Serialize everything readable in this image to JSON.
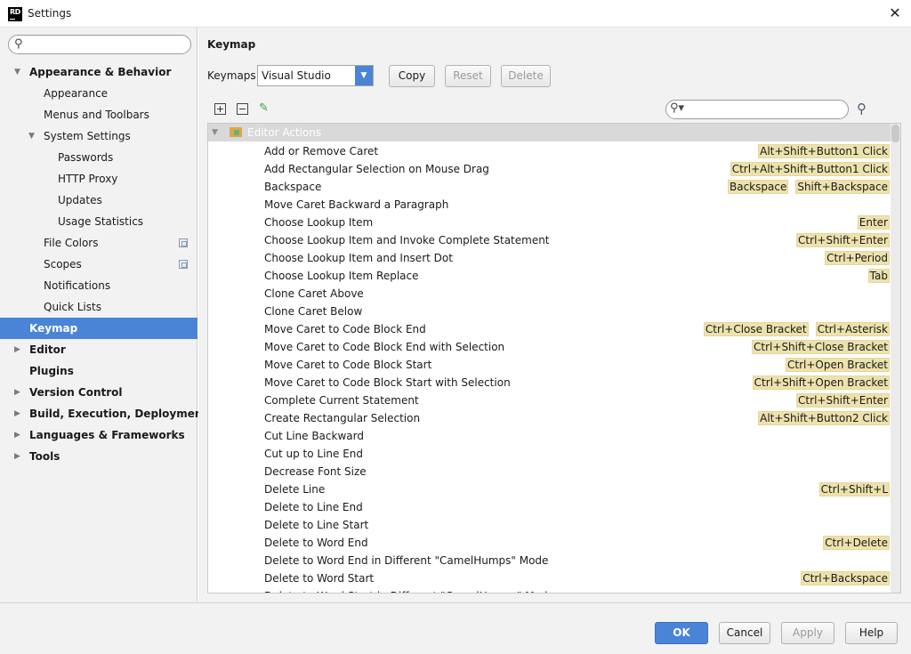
{
  "window": {
    "icon_text": "RD",
    "title": "Settings",
    "close_glyph": "✕"
  },
  "sidebar": {
    "search_placeholder": "",
    "items": [
      {
        "label": "Appearance & Behavior",
        "level": 0,
        "bold": true,
        "expanded": true
      },
      {
        "label": "Appearance",
        "level": 1
      },
      {
        "label": "Menus and Toolbars",
        "level": 1
      },
      {
        "label": "System Settings",
        "level": 1,
        "expanded": true
      },
      {
        "label": "Passwords",
        "level": 2
      },
      {
        "label": "HTTP Proxy",
        "level": 2
      },
      {
        "label": "Updates",
        "level": 2
      },
      {
        "label": "Usage Statistics",
        "level": 2
      },
      {
        "label": "File Colors",
        "level": 1,
        "project_icon": true
      },
      {
        "label": "Scopes",
        "level": 1,
        "project_icon": true
      },
      {
        "label": "Notifications",
        "level": 1
      },
      {
        "label": "Quick Lists",
        "level": 1
      },
      {
        "label": "Keymap",
        "level": 0,
        "bold": true,
        "selected": true
      },
      {
        "label": "Editor",
        "level": 0,
        "bold": true,
        "collapsed": true
      },
      {
        "label": "Plugins",
        "level": 0,
        "bold": true
      },
      {
        "label": "Version Control",
        "level": 0,
        "bold": true,
        "collapsed": true
      },
      {
        "label": "Build, Execution, Deployment",
        "level": 0,
        "bold": true,
        "collapsed": true
      },
      {
        "label": "Languages & Frameworks",
        "level": 0,
        "bold": true,
        "collapsed": true
      },
      {
        "label": "Tools",
        "level": 0,
        "bold": true,
        "collapsed": true
      }
    ]
  },
  "main": {
    "title": "Keymap",
    "keymaps_label": "Keymaps:",
    "keymap_selected": "Visual Studio",
    "copy_label": "Copy",
    "reset_label": "Reset",
    "delete_label": "Delete",
    "expand_all_glyph": "+",
    "collapse_all_glyph": "−",
    "edit_glyph": "✎",
    "action_search_placeholder": "",
    "group_header": "Editor Actions",
    "actions": [
      {
        "name": "Add or Remove Caret",
        "keys": [
          "Alt+Shift+Button1 Click"
        ]
      },
      {
        "name": "Add Rectangular Selection on Mouse Drag",
        "keys": [
          "Ctrl+Alt+Shift+Button1 Click"
        ]
      },
      {
        "name": "Backspace",
        "keys": [
          "Backspace",
          "Shift+Backspace"
        ]
      },
      {
        "name": "Move Caret Backward a Paragraph",
        "keys": []
      },
      {
        "name": "Choose Lookup Item",
        "keys": [
          "Enter"
        ]
      },
      {
        "name": "Choose Lookup Item and Invoke Complete Statement",
        "keys": [
          "Ctrl+Shift+Enter"
        ]
      },
      {
        "name": "Choose Lookup Item and Insert Dot",
        "keys": [
          "Ctrl+Period"
        ]
      },
      {
        "name": "Choose Lookup Item Replace",
        "keys": [
          "Tab"
        ]
      },
      {
        "name": "Clone Caret Above",
        "keys": []
      },
      {
        "name": "Clone Caret Below",
        "keys": []
      },
      {
        "name": "Move Caret to Code Block End",
        "keys": [
          "Ctrl+Close Bracket",
          "Ctrl+Asterisk"
        ]
      },
      {
        "name": "Move Caret to Code Block End with Selection",
        "keys": [
          "Ctrl+Shift+Close Bracket"
        ]
      },
      {
        "name": "Move Caret to Code Block Start",
        "keys": [
          "Ctrl+Open Bracket"
        ]
      },
      {
        "name": "Move Caret to Code Block Start with Selection",
        "keys": [
          "Ctrl+Shift+Open Bracket"
        ]
      },
      {
        "name": "Complete Current Statement",
        "keys": [
          "Ctrl+Shift+Enter"
        ]
      },
      {
        "name": "Create Rectangular Selection",
        "keys": [
          "Alt+Shift+Button2 Click"
        ]
      },
      {
        "name": "Cut Line Backward",
        "keys": []
      },
      {
        "name": "Cut up to Line End",
        "keys": []
      },
      {
        "name": "Decrease Font Size",
        "keys": []
      },
      {
        "name": "Delete Line",
        "keys": [
          "Ctrl+Shift+L"
        ]
      },
      {
        "name": "Delete to Line End",
        "keys": []
      },
      {
        "name": "Delete to Line Start",
        "keys": []
      },
      {
        "name": "Delete to Word End",
        "keys": [
          "Ctrl+Delete"
        ]
      },
      {
        "name": "Delete to Word End in Different \"CamelHumps\" Mode",
        "keys": []
      },
      {
        "name": "Delete to Word Start",
        "keys": [
          "Ctrl+Backspace"
        ]
      },
      {
        "name": "Delete to Word Start in Different \"CamelHumps\" Mode",
        "keys": []
      }
    ]
  },
  "footer": {
    "ok_label": "OK",
    "cancel_label": "Cancel",
    "apply_label": "Apply",
    "help_label": "Help"
  },
  "colors": {
    "selection": "#4a84d7",
    "shortcut_bg": "#ede2ad",
    "panel_bg": "#f2f2f2"
  }
}
